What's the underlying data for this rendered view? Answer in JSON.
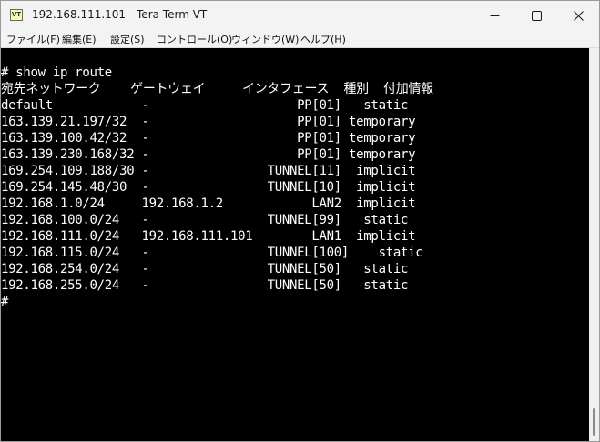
{
  "window": {
    "title": "192.168.111.101 - Tera Term VT",
    "icon_text": "VT"
  },
  "controls": {
    "minimize": "minimize-icon",
    "maximize": "maximize-icon",
    "close": "close-icon"
  },
  "menu": [
    "ファイル(F)",
    "編集(E)",
    "設定(S)",
    "コントロール(O)",
    "ウィンドウ(W)",
    "ヘルプ(H)"
  ],
  "terminal": {
    "colors": {
      "background": "#000000",
      "foreground": "#ffffff"
    },
    "lines": [
      "# show ip route",
      "宛先ネットワーク    ゲートウェイ     インタフェース  種別  付加情報",
      "default            -                    PP[01]   static",
      "163.139.21.197/32  -                    PP[01] temporary",
      "163.139.100.42/32  -                    PP[01] temporary",
      "163.139.230.168/32 -                    PP[01] temporary",
      "169.254.109.188/30 -                TUNNEL[11]  implicit",
      "169.254.145.48/30  -                TUNNEL[10]  implicit",
      "192.168.1.0/24     192.168.1.2            LAN2  implicit",
      "192.168.100.0/24   -                TUNNEL[99]   static",
      "192.168.111.0/24   192.168.111.101        LAN1  implicit",
      "192.168.115.0/24   -                TUNNEL[100]    static",
      "192.168.254.0/24   -                TUNNEL[50]   static",
      "192.168.255.0/24   -                TUNNEL[50]   static",
      "#"
    ]
  }
}
